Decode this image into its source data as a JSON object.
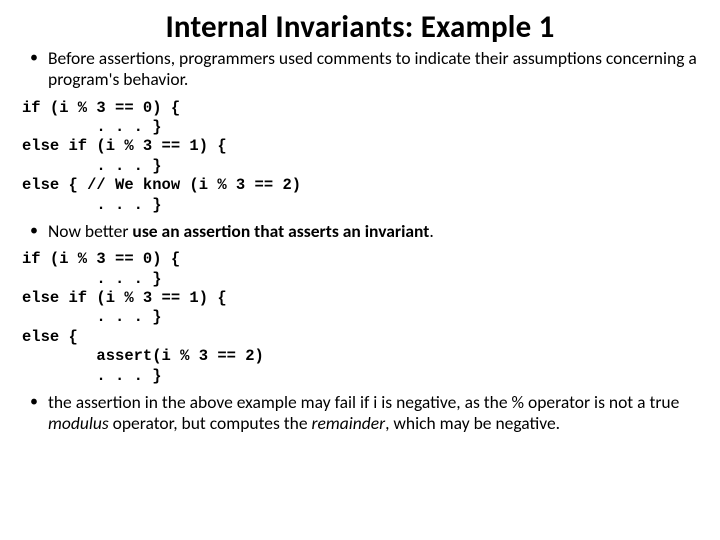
{
  "title": "Internal Invariants: Example 1",
  "bullet1": "Before assertions, programmers used comments to indicate their assumptions concerning a program's behavior.",
  "code1": "if (i % 3 == 0) {\n        . . . }\nelse if (i % 3 == 1) {\n        . . . }\nelse { // We know (i % 3 == 2)\n        . . . }",
  "bullet2_pre": "Now better ",
  "bullet2_bold": "use an assertion that asserts an invariant",
  "bullet2_post": ".",
  "code2": "if (i % 3 == 0) {\n        . . . }\nelse if (i % 3 == 1) {\n        . . . }\nelse {\n        assert(i % 3 == 2)\n        . . . }",
  "bullet3_a": "the assertion in the above example may fail if i is negative, as the % operator is not a true ",
  "bullet3_modulus": "modulus",
  "bullet3_b": " operator, but computes the ",
  "bullet3_remainder": "remainder",
  "bullet3_c": ", which may be negative."
}
